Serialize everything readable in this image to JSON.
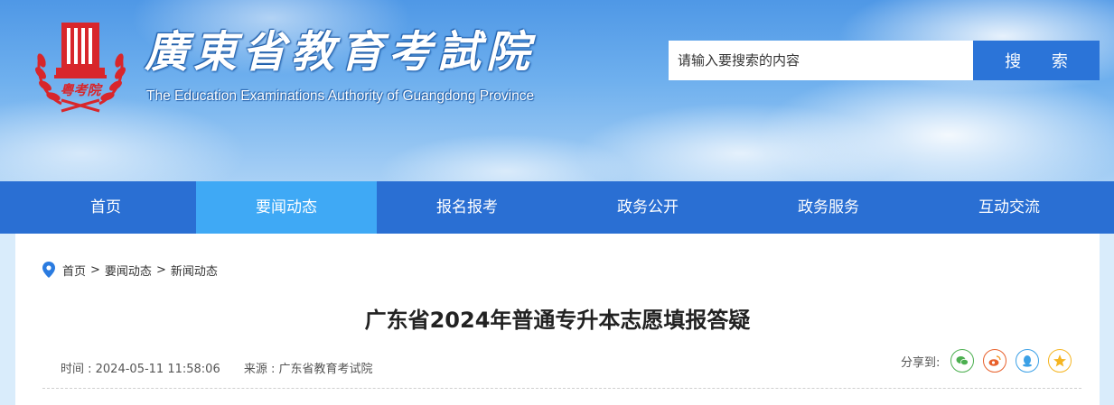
{
  "header": {
    "title": "廣東省教育考試院",
    "subtitle": "The Education Examinations Authority of Guangdong Province",
    "emblem_text": "粤考院",
    "search": {
      "placeholder": "请输入要搜索的内容",
      "button_label": "搜 索"
    }
  },
  "nav": {
    "items": [
      {
        "label": "首页"
      },
      {
        "label": "要闻动态"
      },
      {
        "label": "报名报考"
      },
      {
        "label": "政务公开"
      },
      {
        "label": "政务服务"
      },
      {
        "label": "互动交流"
      }
    ],
    "active_index": 1
  },
  "breadcrumb": {
    "items": [
      "首页",
      "要闻动态",
      "新闻动态"
    ],
    "separator": ">"
  },
  "article": {
    "title": "广东省2024年普通专升本志愿填报答疑",
    "time": "时间 : 2024-05-11 11:58:06",
    "source": "来源 : 广东省教育考试院"
  },
  "share": {
    "label": "分享到:",
    "icons": [
      "wechat-icon",
      "weibo-icon",
      "qq-icon",
      "qzone-icon"
    ]
  },
  "colors": {
    "nav": "#2a6fd3",
    "nav_active": "#3fa9f5",
    "search_button": "#2b74d8",
    "emblem": "#d8262b"
  }
}
